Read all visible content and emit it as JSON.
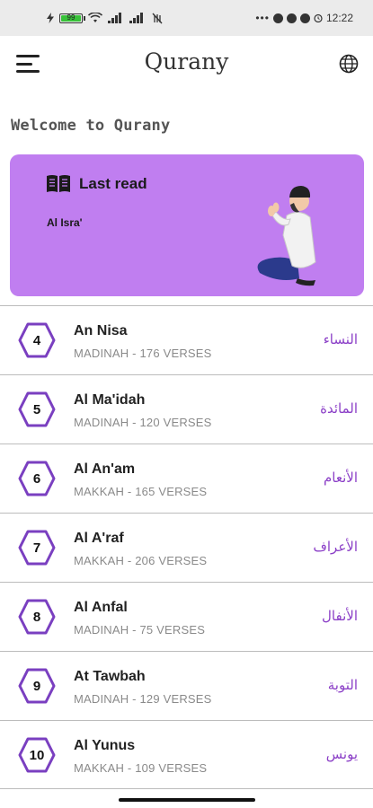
{
  "status_bar": {
    "time": "12:22",
    "battery_percent": "99",
    "battery_level": 0.99,
    "icons": [
      "bolt-icon",
      "battery-icon",
      "wifi-icon",
      "signal-icon",
      "signal-icon",
      "no-data-icon",
      "more-dots-icon",
      "app-notification-icon",
      "app-notification-icon",
      "messenger-icon",
      "alarm-icon"
    ]
  },
  "app_bar": {
    "title": "Qurany",
    "menu_icon": "hamburger-menu-icon",
    "language_icon": "globe-icon"
  },
  "welcome_text": "Welcome to Qurany",
  "last_read": {
    "label": "Last read",
    "surah": "Al Isra'",
    "icon": "open-book-icon",
    "illustration": "praying-man-illustration",
    "background": "#c07ef0"
  },
  "accent_color": "#7a3fc0",
  "surahs": [
    {
      "number": "4",
      "name": "An Nisa",
      "meta": "MADINAH - 176 VERSES",
      "arabic": "النساء"
    },
    {
      "number": "5",
      "name": "Al Ma'idah",
      "meta": "MADINAH - 120 VERSES",
      "arabic": "المائدة"
    },
    {
      "number": "6",
      "name": "Al An'am",
      "meta": "MAKKAH - 165 VERSES",
      "arabic": "الأنعام"
    },
    {
      "number": "7",
      "name": "Al A'raf",
      "meta": "MAKKAH - 206 VERSES",
      "arabic": "الأعراف"
    },
    {
      "number": "8",
      "name": "Al Anfal",
      "meta": "MADINAH - 75 VERSES",
      "arabic": "الأنفال"
    },
    {
      "number": "9",
      "name": "At Tawbah",
      "meta": "MADINAH - 129 VERSES",
      "arabic": "التوبة"
    },
    {
      "number": "10",
      "name": "Al Yunus",
      "meta": "MAKKAH - 109 VERSES",
      "arabic": "يونس"
    }
  ]
}
